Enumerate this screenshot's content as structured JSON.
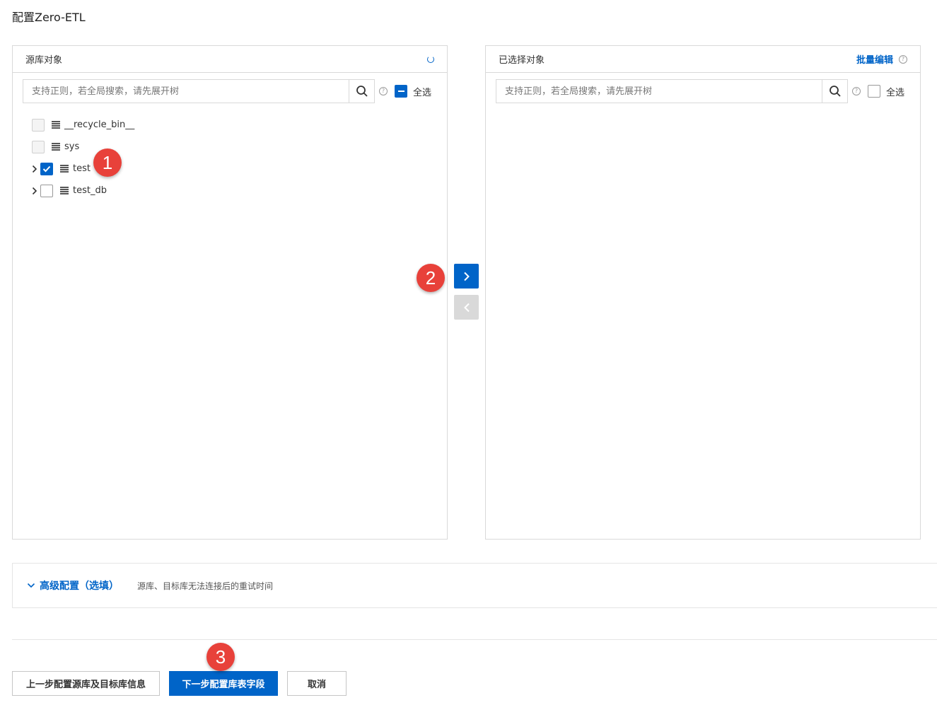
{
  "page": {
    "title": "配置Zero-ETL"
  },
  "source_panel": {
    "title": "源库对象",
    "search_placeholder": "支持正则，若全局搜索，请先展开树",
    "select_all_label": "全选",
    "items": [
      {
        "label": "__recycle_bin__",
        "state": "disabled",
        "expandable": false
      },
      {
        "label": "sys",
        "state": "disabled",
        "expandable": false
      },
      {
        "label": "test",
        "state": "checked",
        "expandable": true
      },
      {
        "label": "test_db",
        "state": "unchecked",
        "expandable": true
      }
    ]
  },
  "selected_panel": {
    "title": "已选择对象",
    "batch_edit_label": "批量编辑",
    "search_placeholder": "支持正则，若全局搜索，请先展开树",
    "select_all_label": "全选"
  },
  "advanced": {
    "label": "高级配置（选填）",
    "description": "源库、目标库无法连接后的重试时间"
  },
  "buttons": {
    "prev": "上一步配置源库及目标库信息",
    "next": "下一步配置库表字段",
    "cancel": "取消"
  },
  "badges": {
    "b1": "1",
    "b2": "2",
    "b3": "3"
  },
  "colors": {
    "primary": "#0064c8",
    "badge": "#e8413a"
  }
}
